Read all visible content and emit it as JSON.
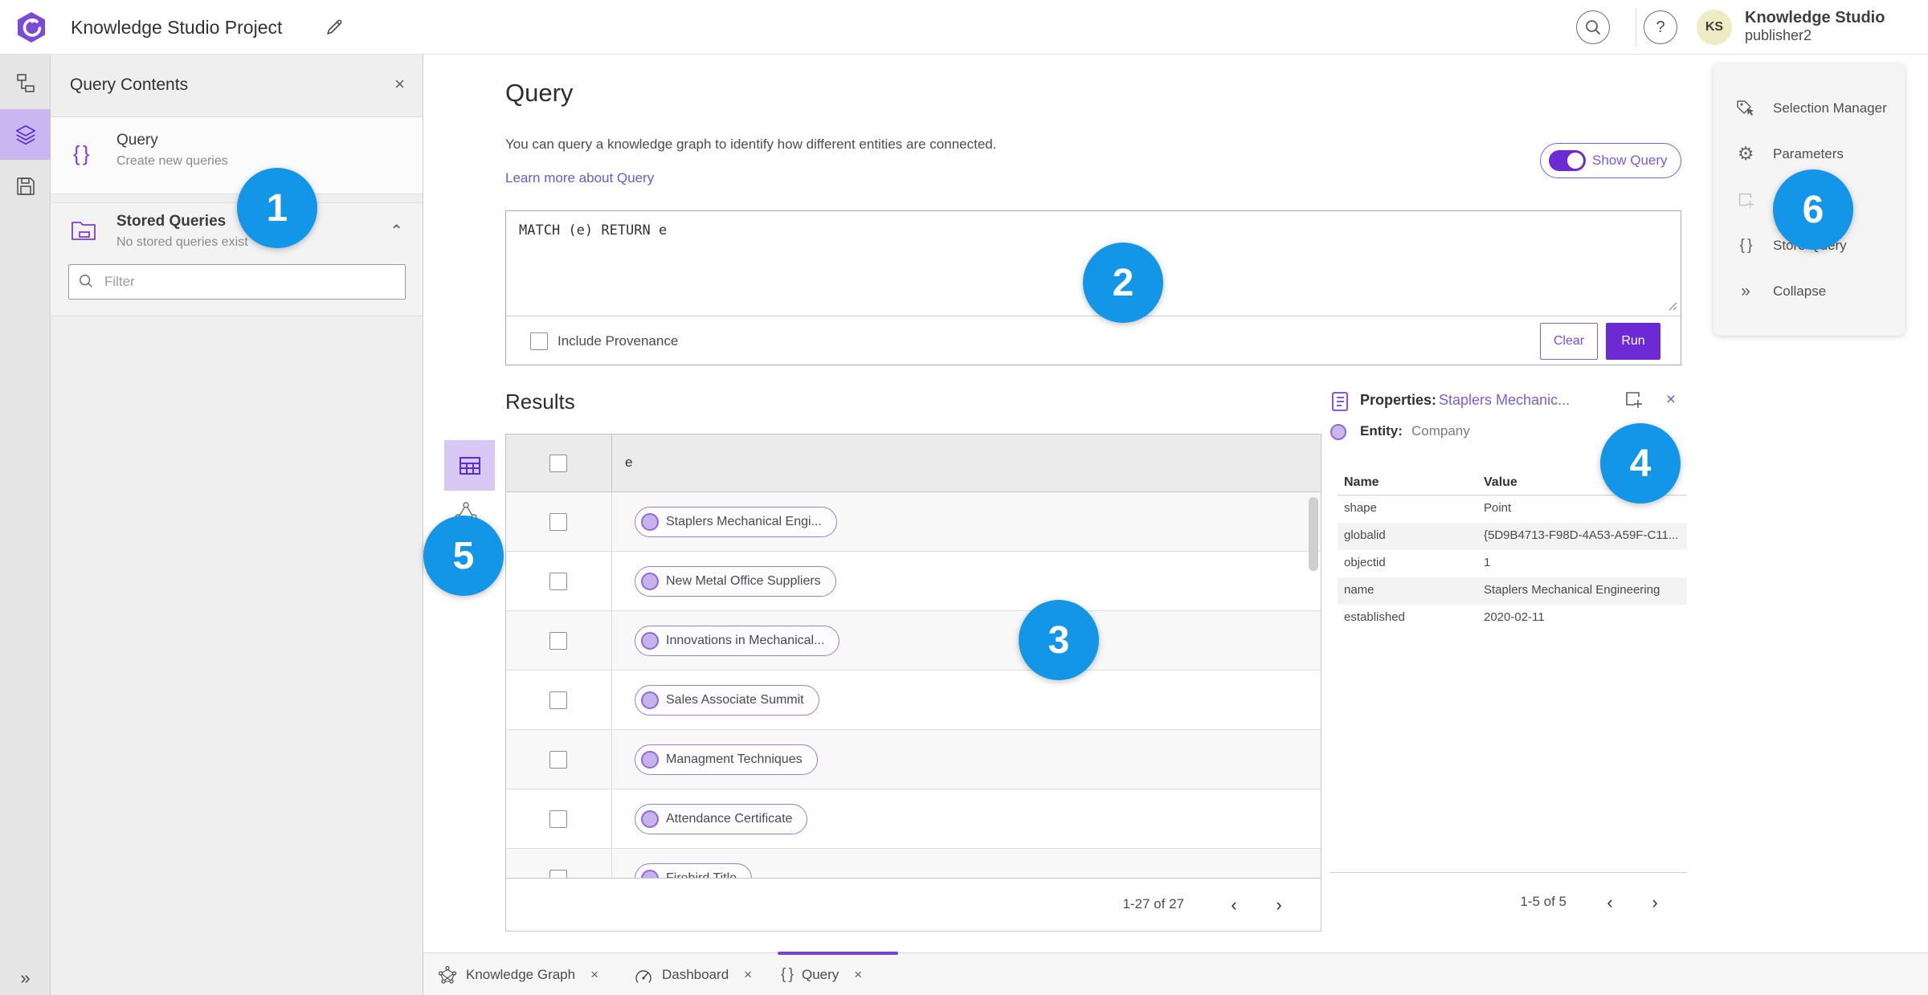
{
  "colors": {
    "accent_purple": "#6d2ad4",
    "selected_rail_purple": "#ccb6f2",
    "chip_border_purple": "#9b7ce0",
    "chip_dot_fill": "#c7b2ec",
    "link_purple": "#685ad1",
    "callout_blue": "#1496e8",
    "avatar_yellow": "#eeecc5"
  },
  "icons": {
    "close": "×",
    "braces": "{ }",
    "collapse_chevrons": "»",
    "expand_chevrons": "»",
    "page_prev": "‹",
    "page_next": "›",
    "section_chevron_up": "⌃",
    "help": "?",
    "gear": "⚙"
  },
  "header": {
    "app_title": "Knowledge Studio Project",
    "user_name": "Knowledge Studio",
    "user_role": "publisher2",
    "avatar_initials": "KS"
  },
  "sidebar": {
    "title": "Query Contents",
    "query_item": {
      "title": "Query",
      "subtitle": "Create new queries"
    },
    "stored_item": {
      "title": "Stored Queries",
      "subtitle": "No stored queries exist"
    },
    "filter_placeholder": "Filter"
  },
  "query_panel": {
    "title": "Query",
    "description": "You can query a knowledge graph to identify how different entities are connected.",
    "learn_more_label": "Learn more about Query",
    "show_query_label": "Show Query",
    "query_text": "MATCH (e) RETURN e",
    "include_provenance_label": "Include Provenance",
    "clear_label": "Clear",
    "run_label": "Run"
  },
  "results": {
    "title": "Results",
    "column_header": "e",
    "rows": [
      "Staplers Mechanical Engi...",
      "New Metal Office Suppliers",
      "Innovations in Mechanical...",
      "Sales Associate Summit",
      "Managment Techniques",
      "Attendance Certificate",
      "Firebird Title"
    ],
    "pagination": "1-27 of 27"
  },
  "properties": {
    "panel_label": "Properties:",
    "entity_link": "Staplers Mechanic...",
    "entity_label": "Entity:",
    "entity_type": "Company",
    "col_name": "Name",
    "col_value": "Value",
    "rows": [
      {
        "name": "shape",
        "value": "Point"
      },
      {
        "name": "globalid",
        "value": "{5D9B4713-F98D-4A53-A59F-C11..."
      },
      {
        "name": "objectid",
        "value": "1"
      },
      {
        "name": "name",
        "value": "Staplers Mechanical Engineering"
      },
      {
        "name": "established",
        "value": "2020-02-11"
      }
    ],
    "pagination": "1-5 of 5"
  },
  "right_menu": {
    "selection_manager": "Selection Manager",
    "parameters": "Parameters",
    "add_truncated": "Ad",
    "store_query": "Store Query",
    "collapse": "Collapse"
  },
  "bottom_tabs": {
    "knowledge_graph": "Knowledge Graph",
    "dashboard": "Dashboard",
    "query": "Query"
  },
  "callouts": [
    "1",
    "2",
    "3",
    "4",
    "5",
    "6"
  ]
}
